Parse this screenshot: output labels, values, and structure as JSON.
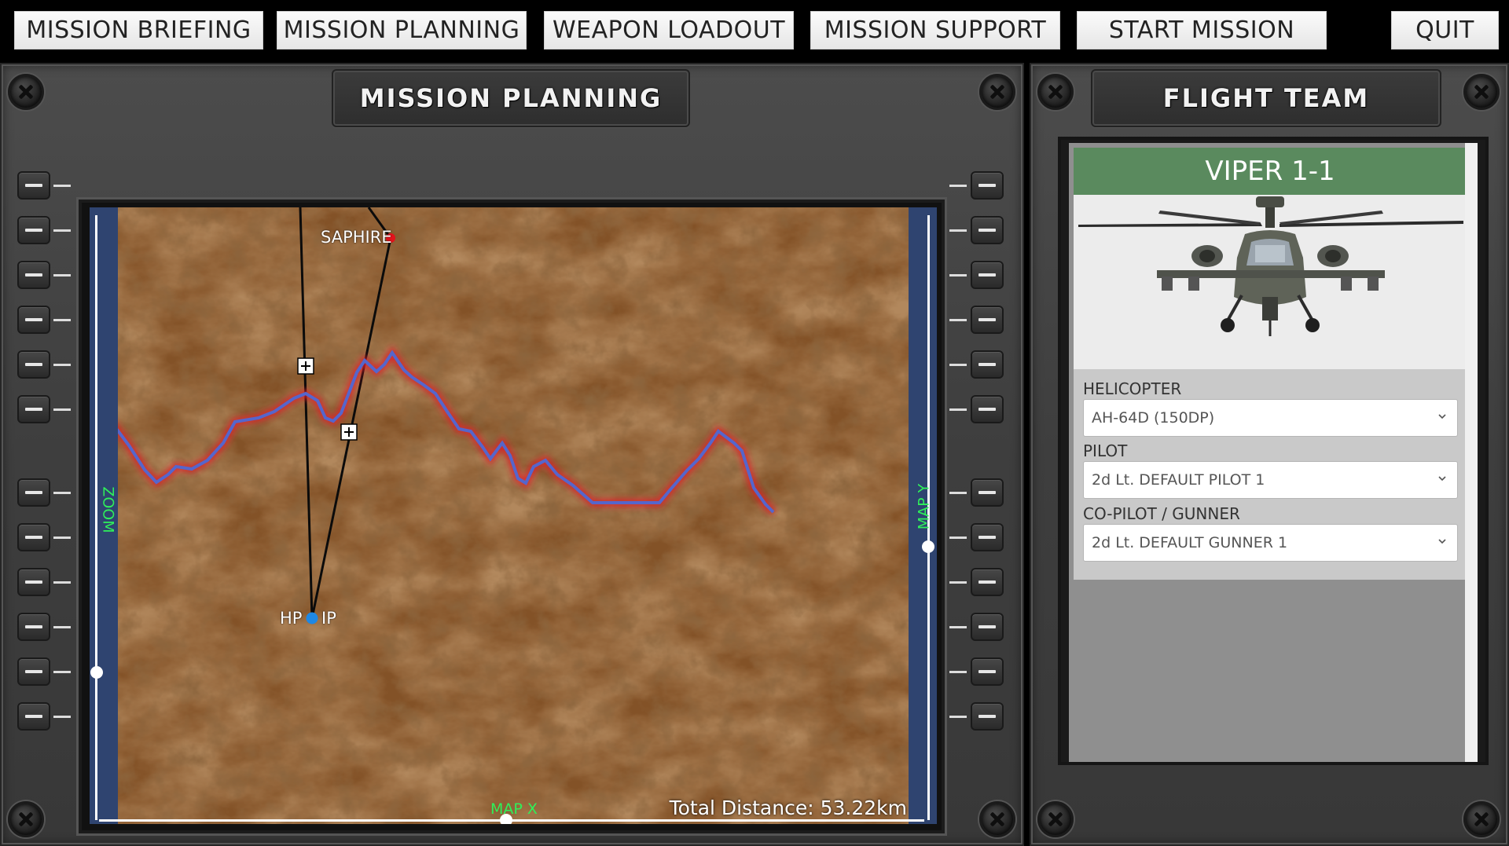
{
  "nav": {
    "items": [
      "MISSION BRIEFING",
      "MISSION PLANNING",
      "WEAPON LOADOUT",
      "MISSION SUPPORT",
      "START MISSION",
      "QUIT"
    ]
  },
  "mission_planning": {
    "title": "MISSION PLANNING",
    "zoom_label": "ZOOM",
    "map_y_label": "MAP Y",
    "map_x_label": "MAP X",
    "waypoints": {
      "saphire": "SAPHIRE",
      "hp": "HP",
      "ip": "IP"
    },
    "total_distance": "Total Distance: 53.22km"
  },
  "flight_team": {
    "title": "FLIGHT TEAM",
    "callsign": "VIPER 1-1",
    "helicopter_label": "HELICOPTER",
    "helicopter_value": "AH-64D (150DP)",
    "pilot_label": "PILOT",
    "pilot_value": "2d Lt. DEFAULT PILOT 1",
    "copilot_label": "CO-PILOT / GUNNER",
    "copilot_value": "2d Lt. DEFAULT GUNNER 1"
  },
  "colors": {
    "callsign_bar": "#5a8a5e",
    "map_rail": "#2f4470",
    "rail_text": "#2ff05a",
    "waypoint_target": "#e3121b",
    "waypoint_start": "#1e88e5",
    "terrain_profile": "#5566cc",
    "terrain_glow": "#e0202a"
  }
}
